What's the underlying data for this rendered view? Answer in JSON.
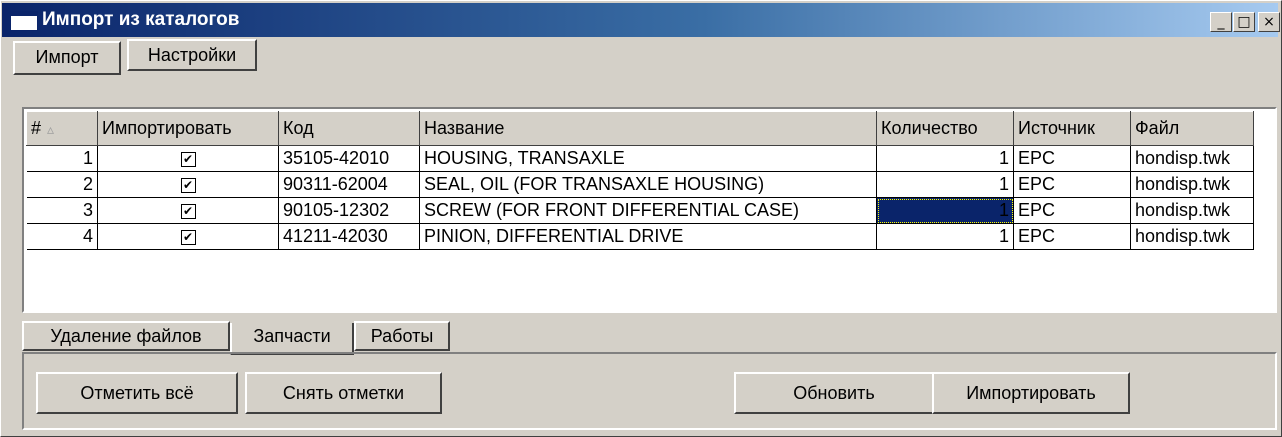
{
  "window": {
    "title": "Импорт из каталогов",
    "controls": {
      "minimize": "_",
      "maximize": "□",
      "close": "×"
    }
  },
  "top_tabs": [
    {
      "label": "Импорт",
      "active": true
    },
    {
      "label": "Настройки",
      "active": false
    }
  ],
  "grid": {
    "headers": [
      "#",
      "Импортировать",
      "Код",
      "Название",
      "Количество",
      "Источник",
      "Файл"
    ],
    "sort_indicator": "▵",
    "rows": [
      {
        "num": "1",
        "import": true,
        "code": "35105-42010",
        "name": "HOUSING, TRANSAXLE",
        "qty": "1",
        "source": "EPC",
        "file": "hondisp.twk"
      },
      {
        "num": "2",
        "import": true,
        "code": "90311-62004",
        "name": "SEAL, OIL (FOR TRANSAXLE HOUSING)",
        "qty": "1",
        "source": "EPC",
        "file": "hondisp.twk"
      },
      {
        "num": "3",
        "import": true,
        "code": "90105-12302",
        "name": "SCREW (FOR FRONT DIFFERENTIAL CASE)",
        "qty": "1",
        "source": "EPC",
        "file": "hondisp.twk"
      },
      {
        "num": "4",
        "import": true,
        "code": "41211-42030",
        "name": "PINION, DIFFERENTIAL DRIVE",
        "qty": "1",
        "source": "EPC",
        "file": "hondisp.twk"
      }
    ],
    "check_glyph": "✔"
  },
  "bottom_tabs": [
    {
      "label": "Удаление файлов",
      "active": false
    },
    {
      "label": "Запчасти",
      "active": true
    },
    {
      "label": "Работы",
      "active": false
    }
  ],
  "buttons": {
    "mark_all": "Отметить всё",
    "unmark": "Снять отметки",
    "refresh": "Обновить",
    "import": "Импортировать"
  },
  "colors": {
    "face": "#d4d0c8",
    "title_start": "#0a246a",
    "title_end": "#a6caf0",
    "selection": "#0a246a"
  },
  "icons": [
    "window-icon",
    "sort-arrow-icon",
    "checkmark-icon"
  ]
}
